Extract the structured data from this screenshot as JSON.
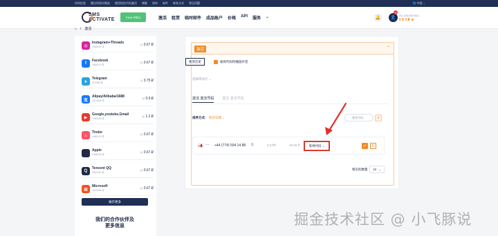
{
  "topbar": {
    "links": [
      "时间信息",
      "塞拉利昂半期选",
      "使用短信代码激活",
      "博客",
      "如何",
      "软件",
      "联系方式",
      "常见问题"
    ],
    "lang": "中国"
  },
  "header": {
    "logo_line1": "SMS",
    "logo_line2": "ACTIVATE",
    "free_button": "Free Pillcs",
    "nav": [
      "激活",
      "租赁",
      "临时邮件",
      "成品账户",
      "价格",
      "API",
      "服务"
    ],
    "user_email": "ISL 6344457611",
    "balance": "0 $ 0 ₽",
    "badge_count": "1"
  },
  "breadcrumb": {
    "current": "激活"
  },
  "services": [
    {
      "name": "Instagram+Threads",
      "count": "4485102 件",
      "price": "0.67 ₽",
      "color": "#d6249f",
      "icon": "instagram-icon",
      "glyph": "◎"
    },
    {
      "name": "Facebook",
      "count": "4485102 件",
      "price": "0.67 ₽",
      "color": "#1877f2",
      "icon": "facebook-icon",
      "glyph": "f"
    },
    {
      "name": "Telegram",
      "count": "870058 件",
      "price": "3.75 ₽",
      "color": "#2aa3dd",
      "icon": "telegram-icon",
      "glyph": "➤"
    },
    {
      "name": "Alipay/Alibaba/1688",
      "count": "4010848 件",
      "price": "0.9 ₽",
      "color": "#1677ff",
      "icon": "alipay-icon",
      "glyph": "支"
    },
    {
      "name": "Google,youtube,Gmail",
      "count": "1084189 件",
      "price": "1.2 ₽",
      "color": "#e33b2e",
      "icon": "google-icon",
      "glyph": "▶"
    },
    {
      "name": "Tinder",
      "count": "4485102 件",
      "price": "0.67 ₽",
      "color": "#fd5068",
      "icon": "tinder-icon",
      "glyph": "♨"
    },
    {
      "name": "Apple",
      "count": "2488169 件",
      "price": "0.67 ₽",
      "color": "#1f2a44",
      "icon": "apple-icon",
      "glyph": ""
    },
    {
      "name": "Tencent QQ",
      "count": "3462383 件",
      "price": "0.67 ₽",
      "color": "#1f2a44",
      "icon": "qq-icon",
      "glyph": "Q"
    },
    {
      "name": "Microsoft",
      "count": "3493388 件",
      "price": "0.67 ₽",
      "color": "#f25022",
      "icon": "microsoft-icon",
      "glyph": "▦"
    }
  ],
  "sidebar": {
    "more_button": "展示更多",
    "partners_line1": "我们的合作伙伴及",
    "partners_line2": "更多信息"
  },
  "panel": {
    "title": "激活",
    "history_button": "租赁历史",
    "notify_label": "收到代码时播放声音",
    "operator": "选择单词计 ⌄",
    "tab_active": "激活 激活号码",
    "tab_inactive": "激活 激活号码",
    "sort_label": "排序方式:",
    "sort_value": "购买日期 ⌄",
    "search_placeholder": "查找号码...",
    "row": {
      "phone": "+44 (774) 594 14 88",
      "time": "9:13牛",
      "price": "10.00 ₽",
      "status": "等待代码 ⌄"
    },
    "page_size_label": "每页的数量",
    "page_size": "10"
  },
  "watermark": "掘金技术社区 @ 小飞豚说"
}
